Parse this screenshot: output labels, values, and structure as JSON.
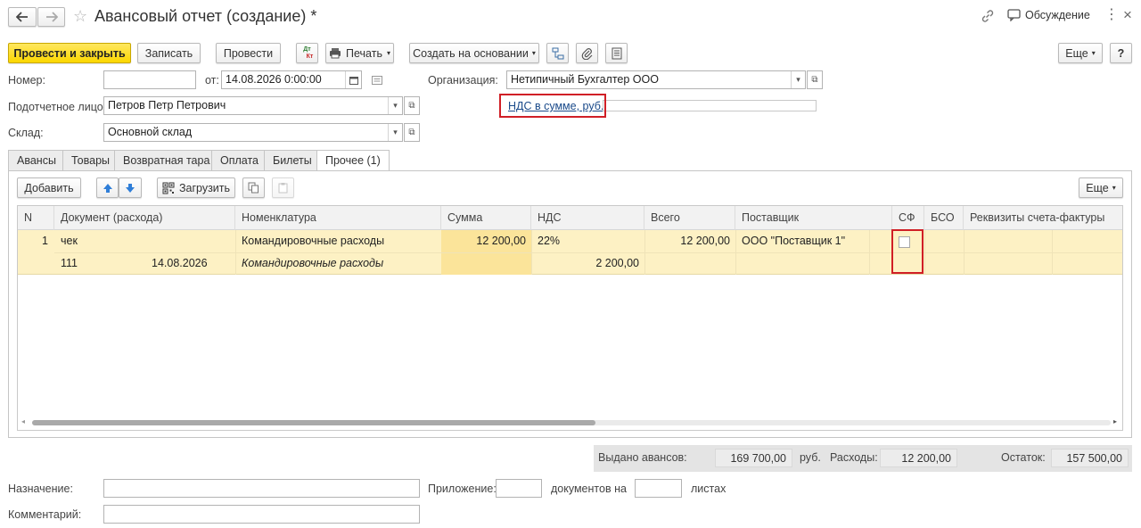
{
  "header": {
    "title": "Авансовый отчет (создание) *",
    "discussion_label": "Обсуждение"
  },
  "toolbar": {
    "post_close": "Провести и закрыть",
    "save": "Записать",
    "post": "Провести",
    "dtkt_top": "Дт",
    "dtkt_bottom": "Кт",
    "print": "Печать",
    "create_based": "Создать на основании",
    "more": "Еще"
  },
  "form": {
    "number_label": "Номер:",
    "number_value": "",
    "date_label": "от:",
    "date_value": "14.08.2026  0:00:00",
    "org_label": "Организация:",
    "org_value": "Нетипичный Бухгалтер ООО",
    "person_label": "Подотчетное лицо:",
    "person_value": "Петров Петр Петрович",
    "vat_link": "НДС в сумме, руб.",
    "warehouse_label": "Склад:",
    "warehouse_value": "Основной склад"
  },
  "tabs": [
    "Авансы",
    "Товары",
    "Возвратная тара",
    "Оплата",
    "Билеты",
    "Прочее (1)"
  ],
  "table_toolbar": {
    "add": "Добавить",
    "load": "Загрузить",
    "more": "Еще"
  },
  "table": {
    "headers": {
      "n": "N",
      "doc": "Документ (расхода)",
      "nom": "Номенклатура",
      "sum": "Сумма",
      "vat": "НДС",
      "total": "Всего",
      "supplier": "Поставщик",
      "sf": "СФ",
      "bso": "БСО",
      "invoice": "Реквизиты счета-фактуры"
    },
    "rows": [
      {
        "n": "1",
        "doc_type": "чек",
        "doc_number": "111",
        "doc_date": "14.08.2026",
        "nomenclature": "Командировочные расходы",
        "nomenclature2": "Командировочные расходы",
        "sum": "12 200,00",
        "vat_rate": "22%",
        "vat_amount": "2 200,00",
        "total": "12 200,00",
        "supplier": "ООО \"Поставщик 1\"",
        "sf_checked": false
      }
    ]
  },
  "totals": {
    "issued_label": "Выдано авансов:",
    "issued_value": "169 700,00",
    "currency": "руб.",
    "expenses_label": "Расходы:",
    "expenses_value": "12 200,00",
    "balance_label": "Остаток:",
    "balance_value": "157 500,00"
  },
  "footer": {
    "purpose_label": "Назначение:",
    "purpose_value": "",
    "attachment_label": "Приложение:",
    "attachment_value": "",
    "docs_on_label": "документов на",
    "sheets_value": "",
    "sheets_label": "листах",
    "comment_label": "Комментарий:",
    "comment_value": ""
  },
  "colors": {
    "primary_button": "#fbd700",
    "row_highlight": "#fdf1c4",
    "sum_cell": "#fbe49a",
    "annotation_red": "#d01f26",
    "link": "#1a4a8a"
  }
}
